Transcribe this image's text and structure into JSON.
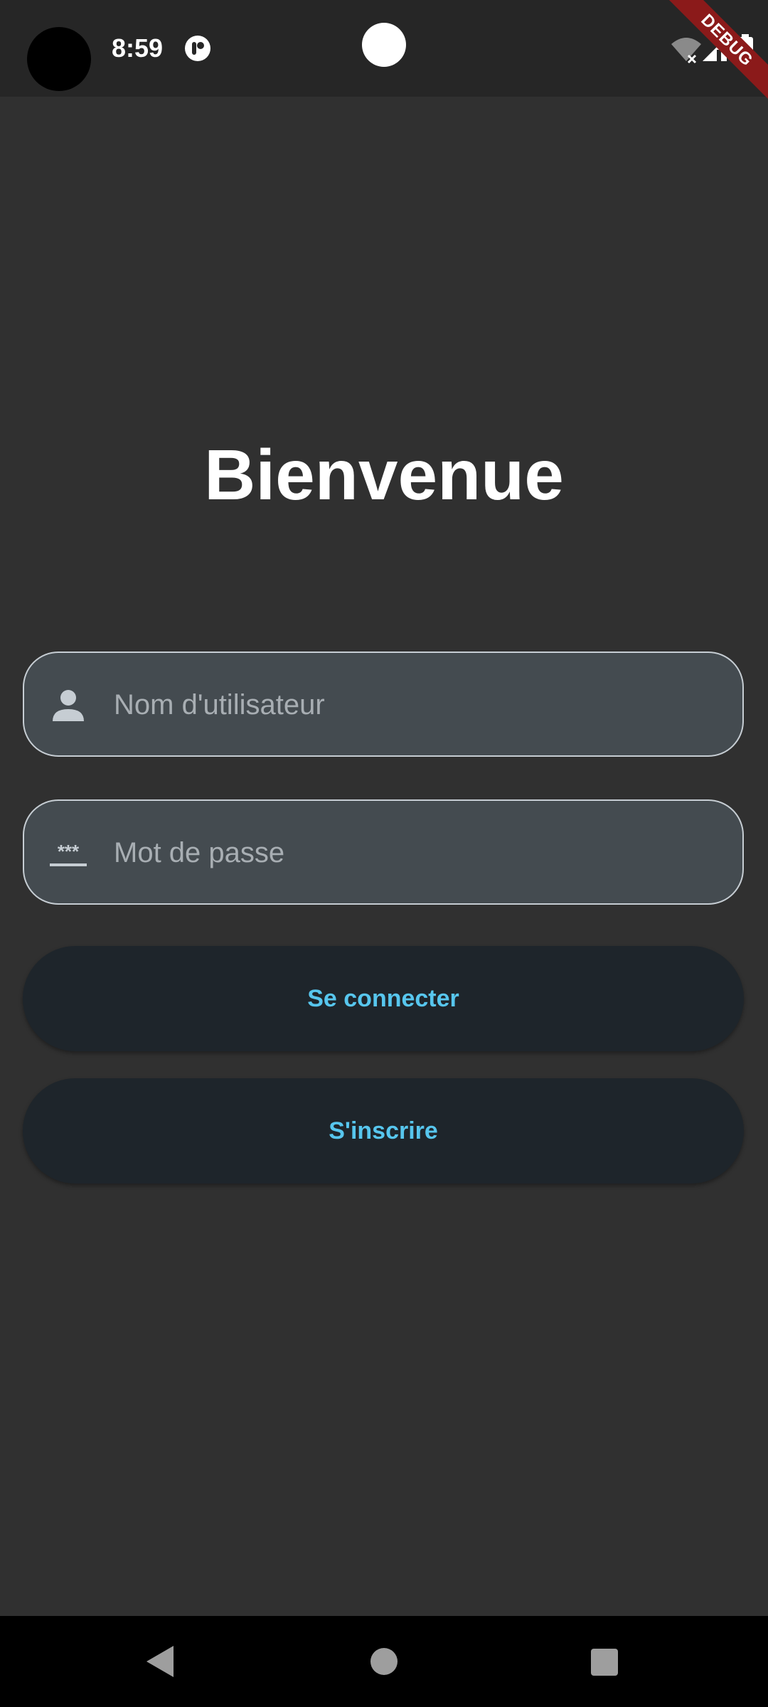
{
  "status_bar": {
    "time": "8:59",
    "icons": [
      "camera-hole",
      "notification-app-icon",
      "wifi-off-icon",
      "cell-signal-icon",
      "battery-icon"
    ]
  },
  "debug_banner": "DEBUG",
  "main": {
    "title": "Bienvenue",
    "username_placeholder": "Nom d'utilisateur",
    "password_placeholder": "Mot de passe",
    "login_label": "Se connecter",
    "signup_label": "S'inscrire"
  },
  "nav_bar": {
    "icons": [
      "back-icon",
      "home-icon",
      "recents-icon"
    ]
  },
  "colors": {
    "background": "#303030",
    "status_bar": "#262626",
    "field_fill": "#444b50",
    "field_border": "#c6cdd3",
    "button_fill": "#1e252b",
    "button_text": "#57c6ee",
    "debug_banner": "#8b1a1a"
  }
}
